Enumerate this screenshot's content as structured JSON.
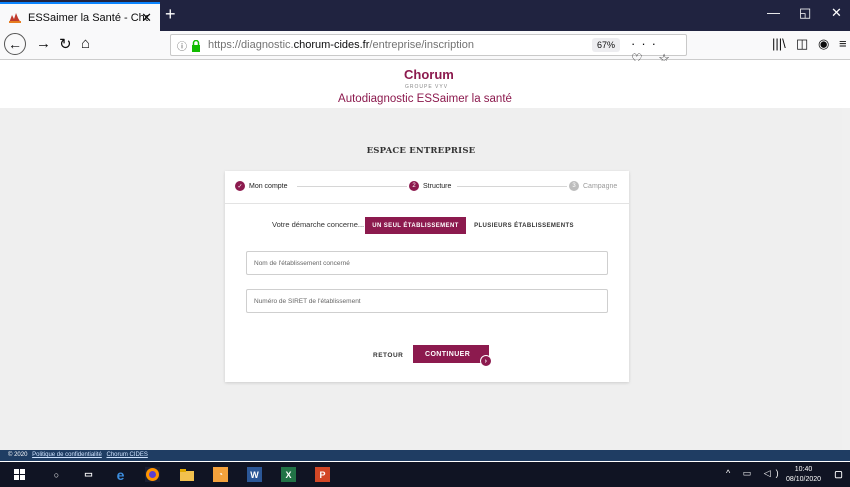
{
  "browser": {
    "tab_title": "ESSaimer la Santé - Chorum",
    "tab_close": "✕",
    "new_tab": "+",
    "url_prefix": "https://diagnostic.",
    "url_domain": "chorum-cides.fr",
    "url_path": "/entreprise/inscription",
    "zoom": "67%",
    "url_actions": "··· ♡ ☆",
    "win_minimize": "—",
    "win_maximize": "◱",
    "win_close": "✕"
  },
  "header": {
    "logo_word": "Chorum",
    "logo_sub": "GROUPE VYV",
    "site_title": "Autodiagnostic ESSaimer la santé"
  },
  "page": {
    "section_title": "ESPACE ENTREPRISE",
    "steps": [
      {
        "number": "✓",
        "label": "Mon compte",
        "state": "done"
      },
      {
        "number": "2",
        "label": "Structure",
        "state": "active"
      },
      {
        "number": "3",
        "label": "Campagne",
        "state": "inactive"
      }
    ],
    "concerne_label": "Votre démarche concerne...",
    "choice_single": "UN SEUL ÉTABLISSEMENT",
    "choice_multiple": "PLUSIEURS ÉTABLISSEMENTS",
    "field_name_placeholder": "Nom de l'établissement concerné",
    "field_siret_placeholder": "Numéro de SIRET de l'établissement",
    "btn_back": "RETOUR",
    "btn_continue": "CONTINUER"
  },
  "footer": {
    "copyright": "© 2020",
    "privacy_link": "Politique de confidentialité",
    "cides_link": "Chorum CIDES"
  },
  "taskbar": {
    "time": "10:40",
    "date": "08/10/2020"
  },
  "colors": {
    "brand": "#8c1a4e",
    "footer": "#1f3d63",
    "taskbar": "#101423"
  }
}
